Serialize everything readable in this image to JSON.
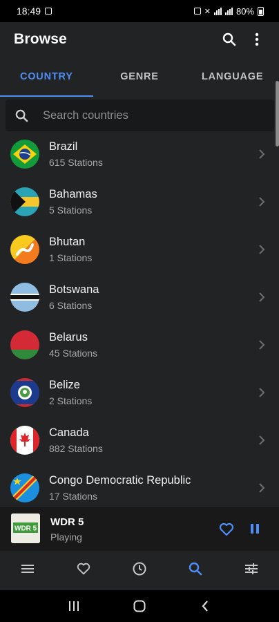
{
  "status_bar": {
    "time": "18:49",
    "battery": "80%"
  },
  "app_bar": {
    "title": "Browse",
    "search_icon": "search-icon",
    "more_icon": "more-vert-icon"
  },
  "tabs": [
    {
      "label": "COUNTRY",
      "active": true
    },
    {
      "label": "GENRE",
      "active": false
    },
    {
      "label": "LANGUAGE",
      "active": false
    }
  ],
  "search": {
    "placeholder": "Search countries",
    "value": ""
  },
  "countries": [
    {
      "name": "Brazil",
      "stations": "615 Stations",
      "flag": "brazil-flag"
    },
    {
      "name": "Bahamas",
      "stations": "5 Stations",
      "flag": "bahamas-flag"
    },
    {
      "name": "Bhutan",
      "stations": "1 Stations",
      "flag": "bhutan-flag"
    },
    {
      "name": "Botswana",
      "stations": "6 Stations",
      "flag": "botswana-flag"
    },
    {
      "name": "Belarus",
      "stations": "45 Stations",
      "flag": "belarus-flag"
    },
    {
      "name": "Belize",
      "stations": "2 Stations",
      "flag": "belize-flag"
    },
    {
      "name": "Canada",
      "stations": "882 Stations",
      "flag": "canada-flag"
    },
    {
      "name": "Congo Democratic Republic",
      "stations": "17 Stations",
      "flag": "congo-dr-flag"
    }
  ],
  "player": {
    "station": "WDR 5",
    "status": "Playing",
    "logo_text": "WDR 5"
  },
  "bottom_nav": [
    {
      "icon": "list-icon",
      "active": false
    },
    {
      "icon": "heart-icon",
      "active": false
    },
    {
      "icon": "history-icon",
      "active": false
    },
    {
      "icon": "search-icon",
      "active": true
    },
    {
      "icon": "equalizer-icon",
      "active": false
    }
  ],
  "colors": {
    "accent": "#4f8ef7",
    "background": "#222325",
    "player_bg": "#19191a",
    "text_secondary": "#a7a7a7"
  }
}
